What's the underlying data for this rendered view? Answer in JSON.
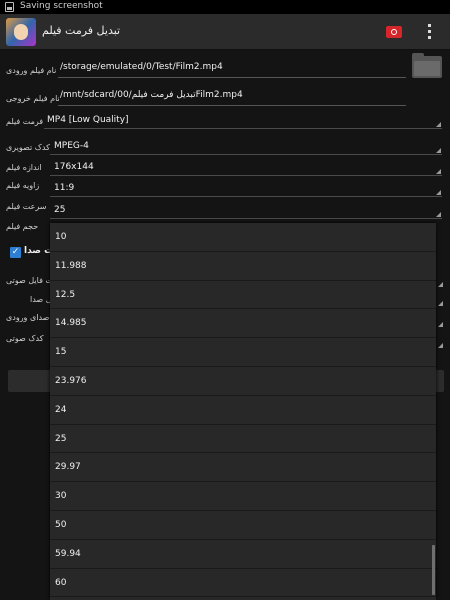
{
  "status_bar": {
    "text": "Saving screenshot"
  },
  "action_bar": {
    "title": "تبدیل فرمت فیلم"
  },
  "form": {
    "input_label": "نام فیلم ورودی",
    "input_value": "/storage/emulated/0/Test/Film2.mp4",
    "output_label": "نام فیلم خروجی",
    "output_value": "/mnt/sdcard/00/تبدیل فرمت فیلمFilm2.mp4",
    "format_label": "فرمت فیلم",
    "format_value": "MP4 [Low Quality]",
    "video_codec_label": "کدک تصویری",
    "video_codec_value": "MPEG-4",
    "size_label": "اندازه فیلم",
    "size_value": "176x144",
    "angle_label": "زاویه فیلم",
    "angle_value": "11:9",
    "fps_label": "سرعت فیلم",
    "fps_value": "25",
    "volume_label": "حجم فیلم",
    "audio_checkbox_label": "ت صدا",
    "audio_file_label": "ت فایل صوتی",
    "audio_label2": "ل صدا",
    "input_audio_label": "ت صدای ورودی",
    "audio_codec_label": "کدک صوتی"
  },
  "dropdown": {
    "options": [
      "10",
      "11.988",
      "12.5",
      "14.985",
      "15",
      "23.976",
      "24",
      "25",
      "29.97",
      "30",
      "50",
      "59.94",
      "60"
    ]
  },
  "icons": {
    "app": "app-logo-icon",
    "red_button": "red-record-icon",
    "menu": "overflow-menu-icon",
    "folder": "folder-icon",
    "status": "screenshot-icon"
  },
  "colors": {
    "accent": "#2e7fd4",
    "red_button": "#d7262b"
  }
}
